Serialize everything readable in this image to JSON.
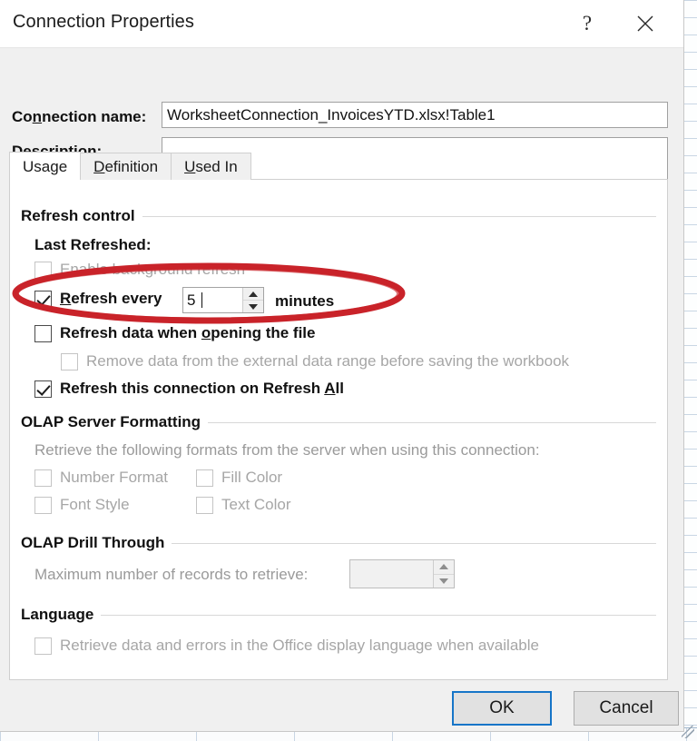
{
  "window": {
    "title": "Connection Properties",
    "help_icon": "question-mark-icon",
    "close_icon": "close-icon"
  },
  "header": {
    "connection_name_label": "Connection name:",
    "connection_name_accel": "n",
    "connection_name_value": "WorksheetConnection_InvoicesYTD.xlsx!Table1",
    "description_label": "Description:",
    "description_value": ""
  },
  "tabs": [
    {
      "label": "Usage",
      "accel": "g",
      "active": true
    },
    {
      "label": "Definition",
      "accel": "D",
      "active": false
    },
    {
      "label": "Used In",
      "accel": "U",
      "active": false
    }
  ],
  "usage_tab": {
    "refresh_control": {
      "group_title": "Refresh control",
      "last_refreshed_label": "Last Refreshed:",
      "last_refreshed_value": "",
      "enable_background_refresh": {
        "label": "Enable background refresh",
        "checked": false,
        "enabled": false
      },
      "refresh_every": {
        "label": "Refresh every",
        "accel": "R",
        "checked": true,
        "enabled": true,
        "value": "5",
        "units_label": "minutes"
      },
      "refresh_on_open": {
        "label": "Refresh data when opening the file",
        "accel": "o",
        "checked": false,
        "enabled": true
      },
      "remove_data_before_save": {
        "label": "Remove data from the external data range before saving the workbook",
        "checked": false,
        "enabled": false
      },
      "refresh_on_refresh_all": {
        "label": "Refresh this connection on Refresh All",
        "accel": "A",
        "checked": true,
        "enabled": true
      }
    },
    "olap_server_formatting": {
      "group_title": "OLAP Server Formatting",
      "intro": "Retrieve the following formats from the server when using this connection:",
      "options": [
        {
          "label": "Number Format",
          "checked": false,
          "enabled": false
        },
        {
          "label": "Fill Color",
          "checked": false,
          "enabled": false
        },
        {
          "label": "Font Style",
          "checked": false,
          "enabled": false
        },
        {
          "label": "Text Color",
          "checked": false,
          "enabled": false
        }
      ]
    },
    "olap_drill_through": {
      "group_title": "OLAP Drill Through",
      "max_records_label": "Maximum number of records to retrieve:",
      "max_records_value": "",
      "enabled": false
    },
    "language": {
      "group_title": "Language",
      "office_display_language": {
        "label": "Retrieve data and errors in the Office display language when available",
        "checked": false,
        "enabled": false
      }
    }
  },
  "footer": {
    "ok_label": "OK",
    "cancel_label": "Cancel"
  },
  "annotation": {
    "shape": "ellipse",
    "color": "#C9232A",
    "target": "Refresh every 5 minutes row"
  }
}
